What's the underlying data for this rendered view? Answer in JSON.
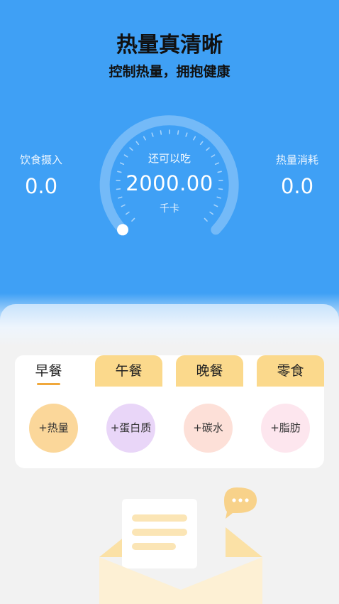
{
  "header": {
    "title": "热量真清晰",
    "subtitle": "控制热量，拥抱健康"
  },
  "stats": {
    "intake": {
      "label": "饮食摄入",
      "value": "0.0"
    },
    "burn": {
      "label": "热量消耗",
      "value": "0.0"
    }
  },
  "gauge": {
    "label": "还可以吃",
    "value": "2000.00",
    "unit": "千卡",
    "progress": 0
  },
  "meals": {
    "tabs": [
      {
        "label": "早餐",
        "active": true
      },
      {
        "label": "午餐",
        "active": false
      },
      {
        "label": "晚餐",
        "active": false
      },
      {
        "label": "零食",
        "active": false
      }
    ]
  },
  "nutrients": [
    {
      "label": "+热量",
      "color": "#fbd79a"
    },
    {
      "label": "+蛋白质",
      "color": "#e9d6f8"
    },
    {
      "label": "+碳水",
      "color": "#fde0d8"
    },
    {
      "label": "+脂肪",
      "color": "#fde6ee"
    }
  ],
  "colors": {
    "primary": "#3fa0f5",
    "tab": "#fbd98c",
    "accent": "#f0a83c"
  },
  "illustration": {
    "icon": "empty-envelope-icon",
    "bubble_icon": "chat-bubble-icon"
  }
}
